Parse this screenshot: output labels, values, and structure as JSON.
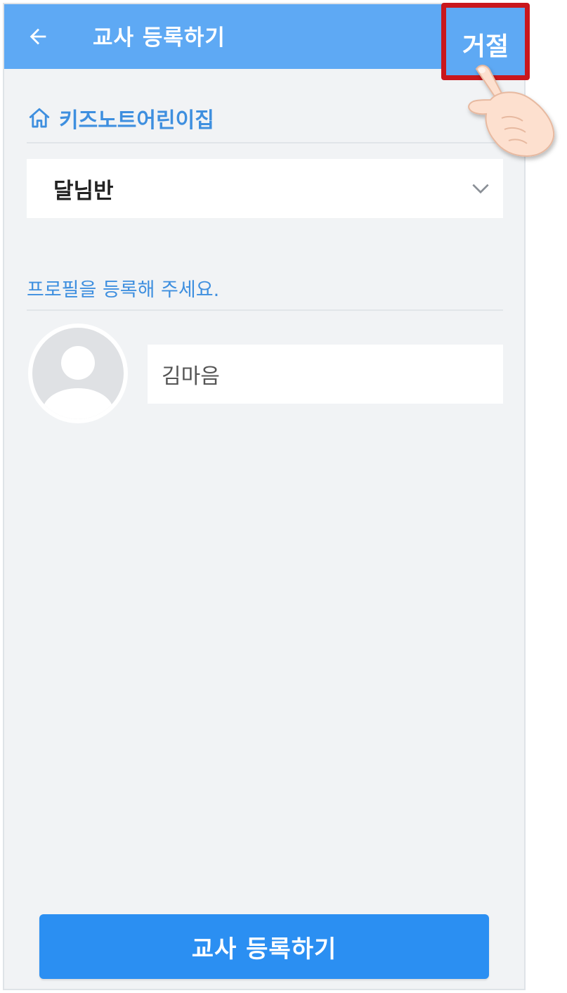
{
  "header": {
    "back_icon": "arrow-left-icon",
    "title": "교사 등록하기",
    "reject_label": "거절"
  },
  "school": {
    "icon": "home-icon",
    "name": "키즈노트어린이집"
  },
  "class_select": {
    "selected": "달님반",
    "caret_icon": "chevron-down-icon"
  },
  "profile": {
    "prompt": "프로필을 등록해 주세요.",
    "avatar_icon": "user-silhouette-icon",
    "name_value": "김마음"
  },
  "footer": {
    "submit_label": "교사 등록하기"
  },
  "annotation": {
    "highlight_color": "#c9171d",
    "pointer": "pointing-hand-icon"
  },
  "colors": {
    "header": "#5ea9f4",
    "accent": "#3e8fdf",
    "button": "#2b8ff2",
    "background": "#f1f3f5"
  }
}
